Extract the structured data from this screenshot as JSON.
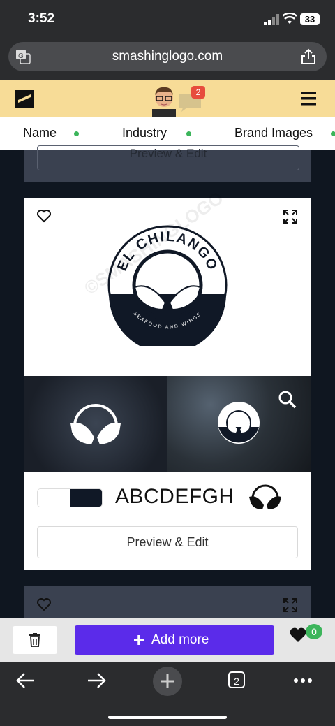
{
  "status_bar": {
    "time": "3:52",
    "battery": "33"
  },
  "browser": {
    "url": "smashinglogo.com",
    "tabs_count": "2"
  },
  "site_header": {
    "chat_badge": "2"
  },
  "tabs": [
    {
      "label": "Name"
    },
    {
      "label": "Industry"
    },
    {
      "label": "Brand Images"
    }
  ],
  "top_card": {
    "button_label": "Preview & Edit"
  },
  "logo_card": {
    "logo_title": "EL CHILANGO",
    "logo_subtitle": "SEAFOOD AND WINGS",
    "watermark": "©SMASHINGLOGO",
    "font_sample": "ABCDEFGH",
    "colors": [
      "#ffffff",
      "#101826"
    ],
    "button_label": "Preview & Edit"
  },
  "action_bar": {
    "add_more_label": "Add more",
    "favorites_count": "0"
  }
}
